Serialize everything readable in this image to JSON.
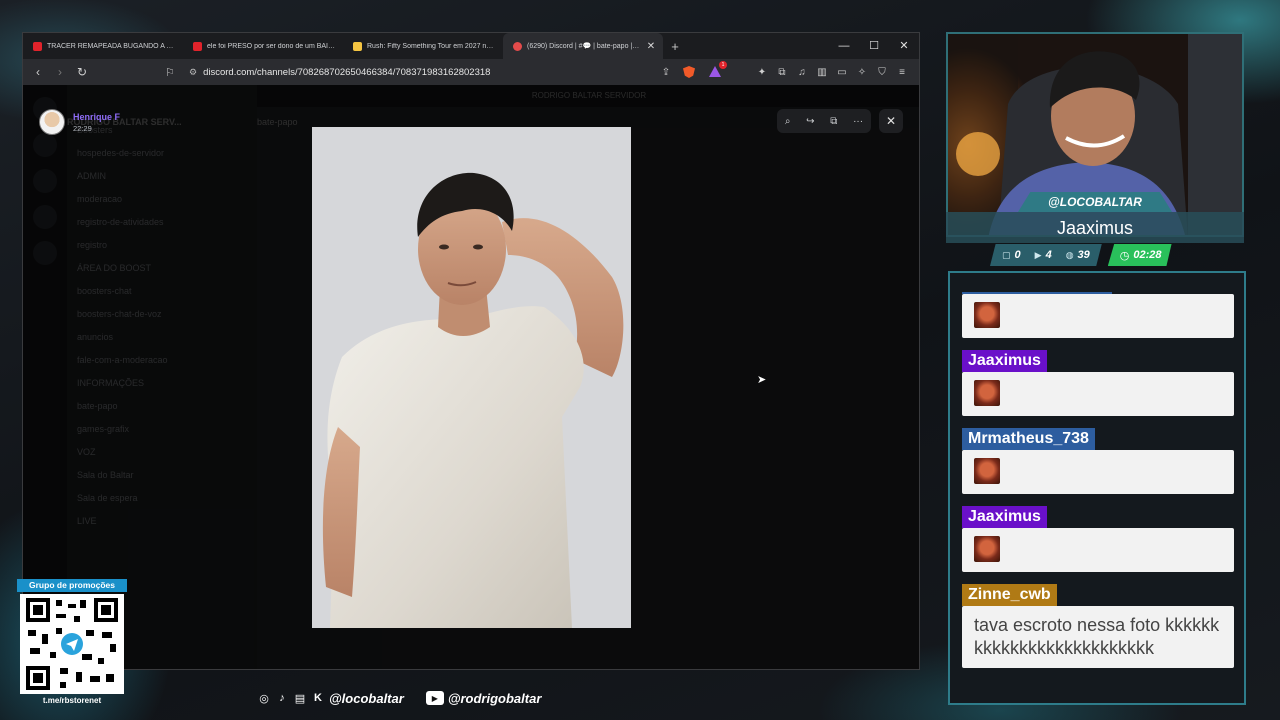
{
  "browser": {
    "tabs": [
      {
        "title": "TRACER REMAPEADA BUGANDO A ZONA N",
        "favicon": "youtube-icon",
        "active": false
      },
      {
        "title": "ele foi PRESO por ser dono de um BAILE FU",
        "favicon": "youtube-icon",
        "active": false
      },
      {
        "title": "Rush: Fifty Something Tour em 2027 no Bra",
        "favicon": "rush-icon",
        "active": false
      },
      {
        "title": "(6290) Discord | #💬 | bate-papo | RO",
        "favicon": "discord-icon",
        "active": true
      }
    ],
    "url": "discord.com/channels/708268702650466384/708371983162802318",
    "rewards_badge": "1"
  },
  "discord_underlay": {
    "server_name": "RODRIGO BALTAR SERV...",
    "top_banner": "RODRIGO BALTAR SERVIDOR",
    "channel_header": "bate-papo",
    "channels": [
      "Boosters",
      "hospedes-de-servidor",
      "ADMIN",
      "moderacao",
      "registro-de-atividades",
      "registro",
      "ÁREA DO BOOST",
      "boosters-chat",
      "boosters-chat-de-voz",
      "anuncios",
      "fale-com-a-moderacao",
      "INFORMAÇÕES",
      "bate-papo",
      "games-grafix",
      "VOZ",
      "Sala do Baltar",
      "Sala de espera",
      "LIVE"
    ]
  },
  "lightbox": {
    "author": "Henrique F",
    "timestamp": "22:29"
  },
  "stream": {
    "handle": "@LOCOBALTAR",
    "latest_follower": "Jaaximus",
    "stats": {
      "subs": "0",
      "youtube": "4",
      "chat": "39"
    },
    "uptime": "02:28"
  },
  "chat": {
    "messages": [
      {
        "user": "",
        "text": "",
        "name_color": "#2d5d9f",
        "emote": true
      },
      {
        "user": "Jaaximus",
        "text": "",
        "name_color": "#6a10c9",
        "emote": true
      },
      {
        "user": "Mrmatheus_738",
        "text": "",
        "name_color": "#2d5d9f",
        "emote": true
      },
      {
        "user": "Jaaximus",
        "text": "",
        "name_color": "#6a10c9",
        "emote": true
      },
      {
        "user": "Zinne_cwb",
        "text": "tava escroto nessa foto kkkkkkkkkkkkkkkkkkkkkkkkkk",
        "name_color": "#b07a15",
        "emote": false
      }
    ]
  },
  "promo": {
    "title": "Grupo de promoções",
    "url": "t.me/rbstorenet"
  },
  "socials": {
    "handle_main": "@locobaltar",
    "handle_youtube": "@rodrigobaltar"
  }
}
